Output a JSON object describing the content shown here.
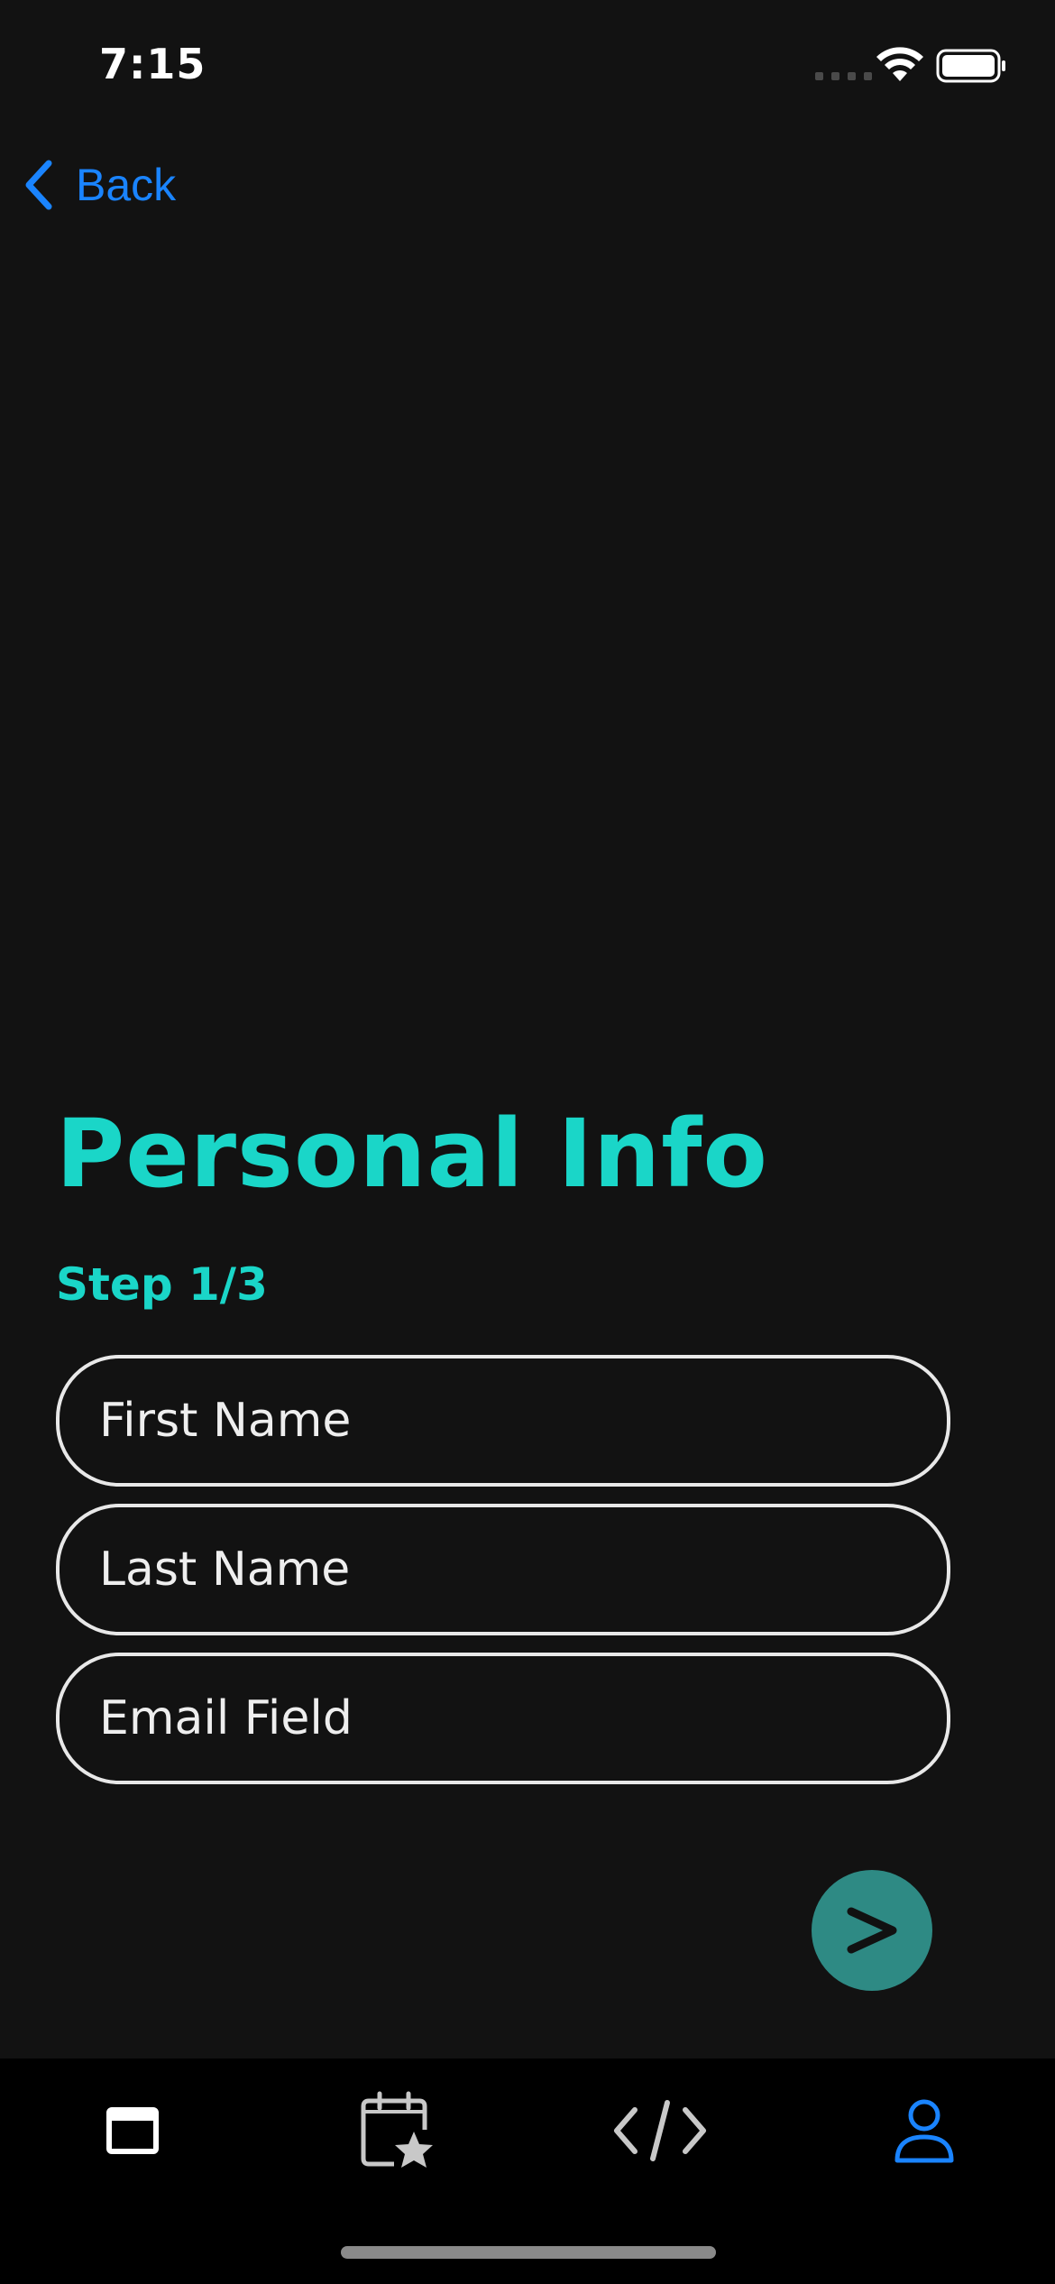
{
  "status_bar": {
    "time": "7:15",
    "wifi_icon": "wifi-icon",
    "battery_icon": "battery-icon"
  },
  "nav": {
    "back_label": "Back",
    "back_icon": "chevron-left-icon"
  },
  "form": {
    "title": "Personal Info",
    "step": "Step 1/3",
    "fields": {
      "first_name_placeholder": "First Name",
      "last_name_placeholder": "Last Name",
      "email_placeholder": "Email Field"
    },
    "next_icon": "chevron-right-icon"
  },
  "tab_bar": {
    "tabs": [
      {
        "icon": "window-icon",
        "active": false
      },
      {
        "icon": "calendar-star-icon",
        "active": false
      },
      {
        "icon": "code-icon",
        "active": false
      },
      {
        "icon": "person-icon",
        "active": true
      }
    ]
  },
  "colors": {
    "background": "#121212",
    "accent": "#1ad6c8",
    "link_blue": "#1a84ff",
    "next_button": "#2e8a84",
    "tab_bar": "#000000"
  }
}
